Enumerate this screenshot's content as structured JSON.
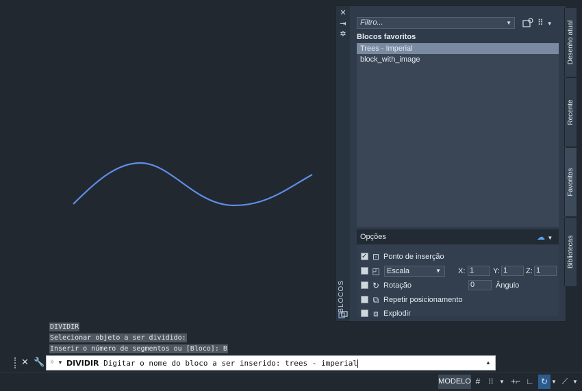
{
  "palette": {
    "strip_title": "BLOCOS",
    "filter_placeholder": "Filtro...",
    "favorites_heading": "Blocos favoritos",
    "blocks": [
      {
        "name": "Trees - Imperial",
        "selected": true
      },
      {
        "name": "block_with_image",
        "selected": false
      }
    ],
    "options": {
      "header": "Opções",
      "insertion_point": {
        "label": "Ponto de inserção",
        "checked": true
      },
      "scale": {
        "select_value": "Escala",
        "checked": false,
        "x_label": "X:",
        "x": "1",
        "y_label": "Y:",
        "y": "1",
        "z_label": "Z:",
        "z": "1"
      },
      "rotation": {
        "label": "Rotação",
        "checked": false,
        "value": "0",
        "angle_label": "Ângulo"
      },
      "repeat": {
        "label": "Repetir posicionamento",
        "checked": false
      },
      "explode": {
        "label": "Explodir",
        "checked": false
      }
    }
  },
  "tabs": [
    {
      "label": "Desenho atual",
      "active": false
    },
    {
      "label": "Recente",
      "active": false
    },
    {
      "label": "Favoritos",
      "active": true
    },
    {
      "label": "Bibliotecas",
      "active": false
    }
  ],
  "command_history": [
    "DIVIDIR",
    "Selecionar objeto a ser dividido:",
    "Inserir o número de segmentos ou [Bloco]: B"
  ],
  "command_line": {
    "command": "DIVIDIR",
    "prompt": "Digitar o nome do bloco a ser inserido: trees - imperial"
  },
  "status_bar": {
    "model_label": "MODELO"
  },
  "colors": {
    "canvas_bg": "#212830",
    "curve": "#5f8de8",
    "selection": "#7a8aa1"
  }
}
